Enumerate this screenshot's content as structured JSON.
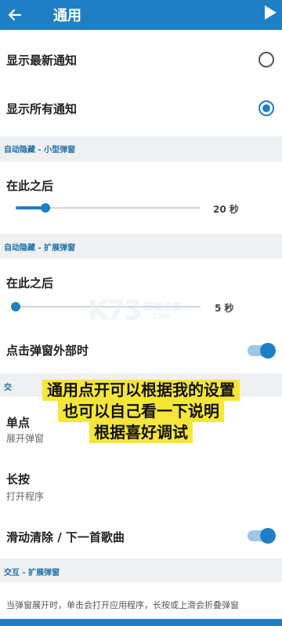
{
  "appbar": {
    "title": "通用",
    "back_icon": "arrow-left-icon",
    "play_icon": "play-icon"
  },
  "notifications": {
    "latest_label": "显示最新通知",
    "all_label": "显示所有通知",
    "selected": "all"
  },
  "auto_hide_small": {
    "header": "自动隐藏 - 小型弹窗",
    "after_label": "在此之后",
    "slider_fraction": 0.16,
    "value_text": "20 秒"
  },
  "auto_hide_expanded": {
    "header": "自动隐藏 - 扩展弹窗",
    "after_label": "在此之后",
    "slider_fraction": 0.0,
    "value_text": "5 秒",
    "outside_click_label": "点击弹窗外部时",
    "outside_click_on": true
  },
  "interaction_small": {
    "header": "交",
    "single_tap_label": "单点",
    "single_tap_sub": "展开弹窗",
    "long_press_label": "长按",
    "long_press_sub": "打开程序",
    "swipe_label": "滑动清除 / 下一首歌曲",
    "swipe_on": true
  },
  "interaction_expanded": {
    "header": "交互 - 扩展弹窗",
    "description": "当弹窗展开时，单击会打开应用程序，长按或上滑会折叠弹窗"
  },
  "overlay": {
    "lines": [
      "通用点开可以根据我的设置",
      "也可以自己看一下说明",
      "根据喜好调试"
    ]
  },
  "watermark": {
    "brand": "K73",
    "cn": "游戏之家",
    "domain": ".com"
  },
  "colors": {
    "primary": "#1e7fc4",
    "section_bg": "#eef0f2",
    "highlight": "#f5e63a"
  }
}
